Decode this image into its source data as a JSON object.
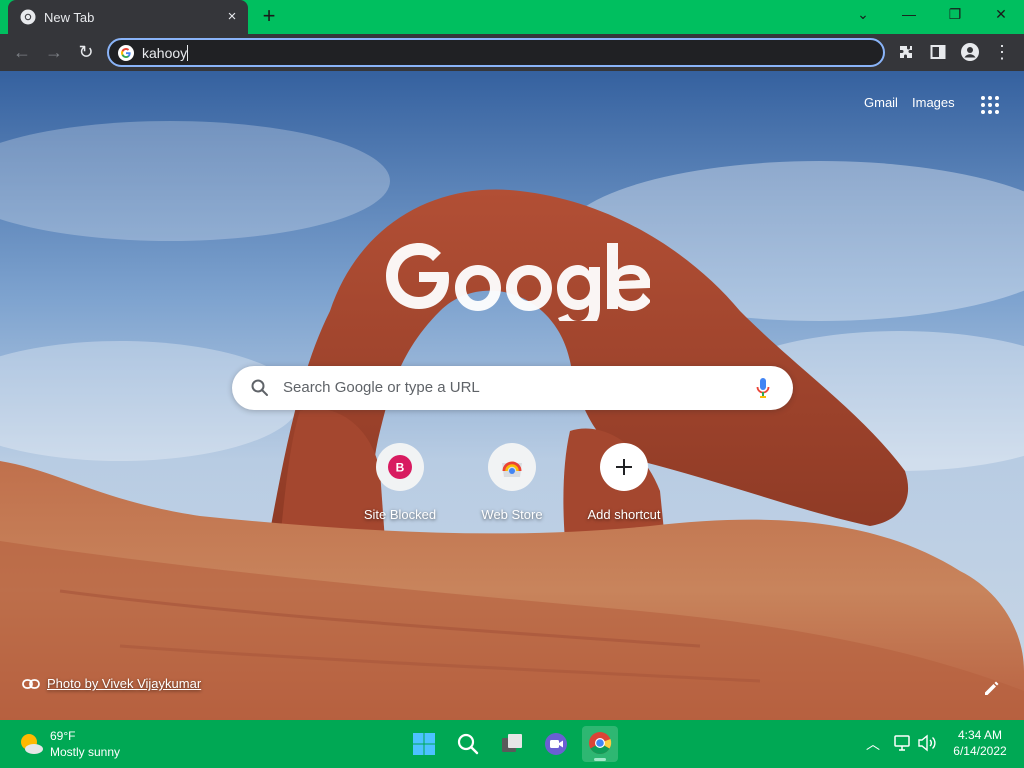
{
  "browser": {
    "tab": {
      "title": "New Tab",
      "close_glyph": "×"
    },
    "new_tab_glyph": "+",
    "window_controls": {
      "chevron": "⌄",
      "minimize": "—",
      "restore": "❐",
      "close": "✕"
    },
    "toolbar": {
      "back_glyph": "←",
      "forward_glyph": "→",
      "reload_glyph": "↻",
      "address_text": "kahooy",
      "menu_glyph": "⋮"
    },
    "colors": {
      "tabstrip": "#00bf5f",
      "toolbar": "#35363a",
      "omnibox_focus": "#8ab4f8"
    }
  },
  "ntp": {
    "links": {
      "gmail": "Gmail",
      "images": "Images"
    },
    "search_placeholder": "Search Google or type a URL",
    "shortcuts": [
      {
        "label": "Site Blocked",
        "icon": "letter-b-icon",
        "letter": "B"
      },
      {
        "label": "Web Store",
        "icon": "web-store-icon"
      },
      {
        "label": "Add shortcut",
        "icon": "plus-icon",
        "glyph": "+"
      }
    ],
    "photo_credit": "Photo by Vivek Vijaykumar"
  },
  "taskbar": {
    "weather": {
      "temp": "69°F",
      "condition": "Mostly sunny"
    },
    "apps": [
      "start-icon",
      "search-icon",
      "task-view-icon",
      "chat-icon",
      "chrome-icon"
    ],
    "tray": {
      "chevron": "︿"
    },
    "clock": {
      "time": "4:34 AM",
      "date": "6/14/2022"
    },
    "color": "#00a854"
  }
}
